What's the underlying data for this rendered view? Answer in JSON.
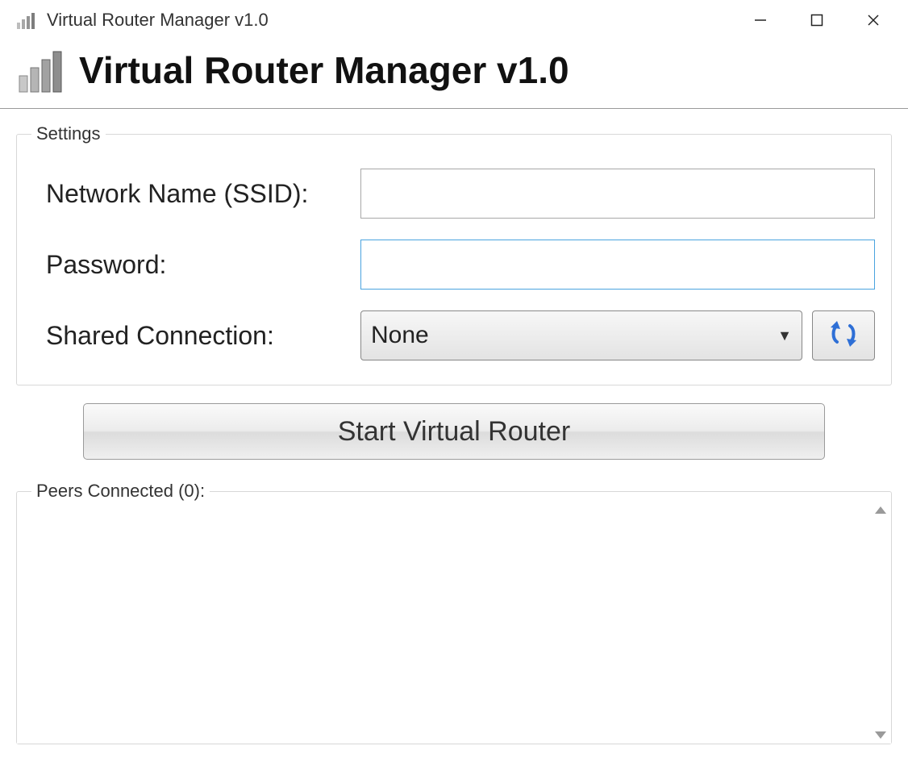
{
  "window": {
    "title": "Virtual Router Manager v1.0"
  },
  "banner": {
    "heading": "Virtual Router Manager v1.0"
  },
  "settings": {
    "legend": "Settings",
    "ssid_label": "Network Name (SSID):",
    "ssid_value": "",
    "password_label": "Password:",
    "password_value": "",
    "shared_label": "Shared Connection:",
    "shared_selected": "None"
  },
  "actions": {
    "start_label": "Start Virtual Router"
  },
  "peers": {
    "legend": "Peers Connected (0):",
    "count": 0
  }
}
